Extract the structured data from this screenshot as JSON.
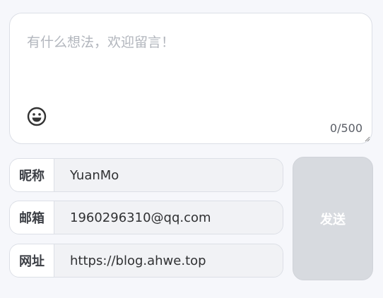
{
  "comment": {
    "placeholder": "有什么想法，欢迎留言！",
    "value": "",
    "counter": "0/500",
    "emoji_icon": "smiley-face-icon"
  },
  "fields": [
    {
      "label": "昵称",
      "value": "YuanMo"
    },
    {
      "label": "邮箱",
      "value": "1960296310@qq.com"
    },
    {
      "label": "网址",
      "value": "https://blog.ahwe.top"
    }
  ],
  "send_button": {
    "label": "发送",
    "state": "disabled",
    "color": "#d7dadf"
  }
}
